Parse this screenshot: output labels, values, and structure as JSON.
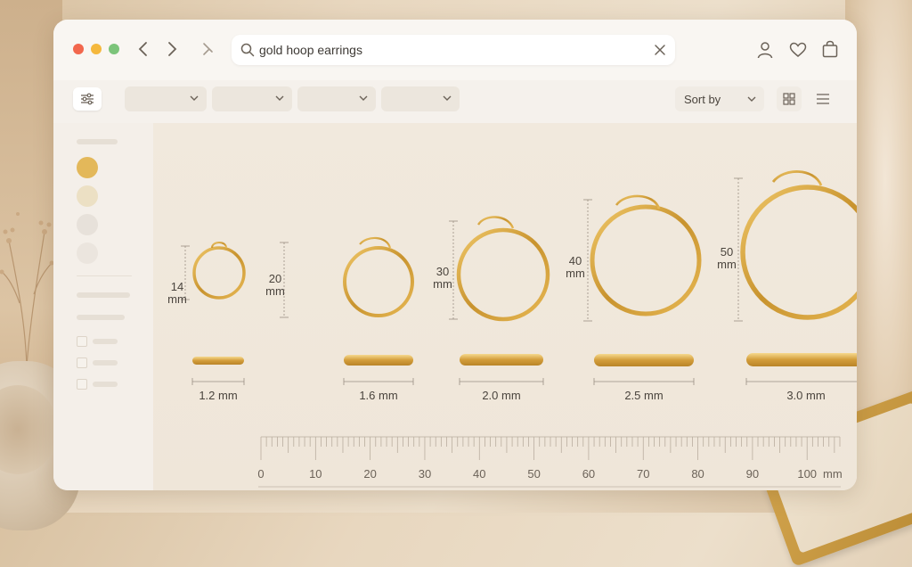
{
  "browser": {
    "search_value": "gold hoop earrings"
  },
  "toolbar": {
    "sort_label": "Sort by"
  },
  "hoops": [
    {
      "size_value": "14",
      "size_unit": "mm",
      "thickness": "1.2 mm"
    },
    {
      "size_value": "20",
      "size_unit": "mm",
      "thickness": "1.6 mm"
    },
    {
      "size_value": "30",
      "size_unit": "mm",
      "thickness": "2.0 mm"
    },
    {
      "size_value": "40",
      "size_unit": "mm",
      "thickness": "2.5 mm"
    },
    {
      "size_value": "50",
      "size_unit": "mm",
      "thickness": "3.0 mm"
    }
  ],
  "ruler": {
    "labels": [
      "0",
      "10",
      "20",
      "30",
      "40",
      "50",
      "60",
      "70",
      "80",
      "90",
      "100"
    ],
    "unit": "mm"
  },
  "colors": {
    "gold": "#d6a53c",
    "window_bg": "#f7f3ee",
    "close_dot": "#f2674d",
    "min_dot": "#f5b83d",
    "max_dot": "#7cc47a"
  },
  "icons": [
    "back-icon",
    "forward-icon",
    "refresh-icon",
    "search-icon",
    "clear-icon",
    "user-icon",
    "heart-icon",
    "bag-icon",
    "filter-icon",
    "grid-view-icon",
    "list-view-icon"
  ]
}
